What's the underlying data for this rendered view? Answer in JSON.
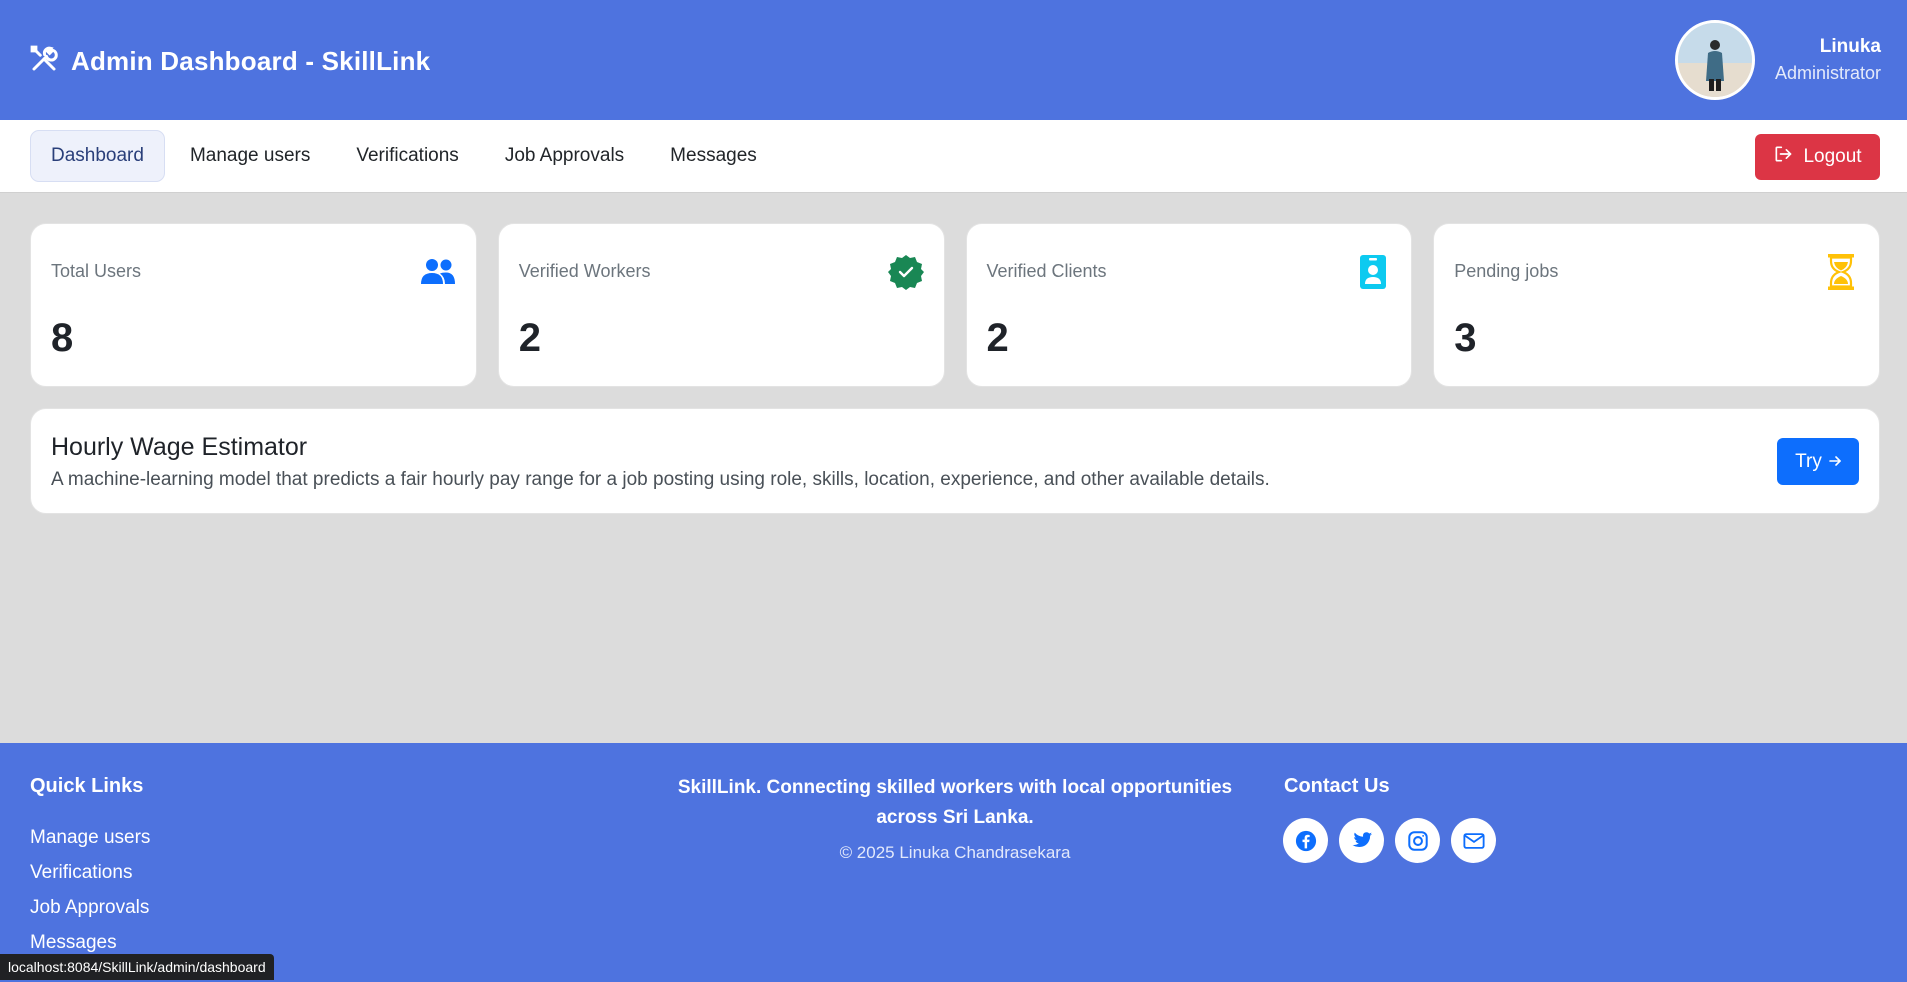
{
  "header": {
    "title": "Admin Dashboard - SkillLink",
    "user_name": "Linuka",
    "user_role": "Administrator"
  },
  "nav": {
    "items": [
      {
        "label": "Dashboard",
        "active": true
      },
      {
        "label": "Manage users"
      },
      {
        "label": "Verifications"
      },
      {
        "label": "Job Approvals"
      },
      {
        "label": "Messages"
      }
    ],
    "logout_label": "Logout"
  },
  "stats": [
    {
      "label": "Total Users",
      "value": "8",
      "icon": "users-icon",
      "color": "#0d6efd"
    },
    {
      "label": "Verified Workers",
      "value": "2",
      "icon": "verified-badge-icon",
      "color": "#198754"
    },
    {
      "label": "Verified Clients",
      "value": "2",
      "icon": "id-badge-icon",
      "color": "#0dcaf0"
    },
    {
      "label": "Pending jobs",
      "value": "3",
      "icon": "hourglass-icon",
      "color": "#ffc107"
    }
  ],
  "estimator": {
    "title": "Hourly Wage Estimator",
    "description": "A machine-learning model that predicts a fair hourly pay range for a job posting using role, skills, location, experience, and other available details.",
    "button_label": "Try"
  },
  "footer": {
    "quick_links_title": "Quick Links",
    "quick_links": [
      "Manage users",
      "Verifications",
      "Job Approvals",
      "Messages"
    ],
    "tagline": "SkillLink. Connecting skilled workers with local opportunities across Sri Lanka.",
    "copyright": "© 2025 Linuka Chandrasekara",
    "contact_title": "Contact Us",
    "socials": [
      "facebook-icon",
      "twitter-icon",
      "instagram-icon",
      "email-icon"
    ]
  },
  "status_bar": {
    "url": "localhost:8084/SkillLink/admin/dashboard"
  },
  "colors": {
    "primary": "#4e73df",
    "danger": "#dc3545",
    "accent": "#0d6efd"
  }
}
